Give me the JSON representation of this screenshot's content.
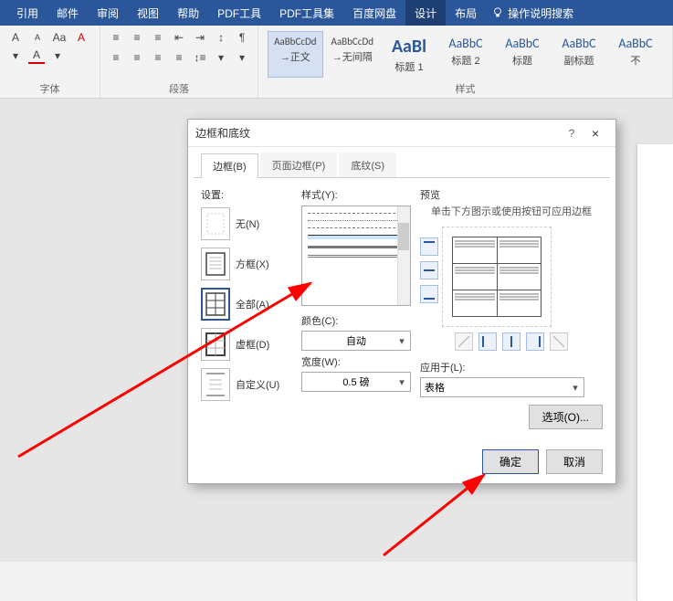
{
  "ribbon": {
    "tabs": [
      "引用",
      "邮件",
      "审阅",
      "视图",
      "帮助",
      "PDF工具",
      "PDF工具集",
      "百度网盘",
      "设计",
      "布局"
    ],
    "help_search": "操作说明搜索"
  },
  "ribbon_groups": {
    "font": "字体",
    "paragraph": "段落",
    "styles": "样式"
  },
  "styles_gallery": [
    {
      "preview": "AaBbCcDd",
      "name": "→正文",
      "size": "small"
    },
    {
      "preview": "AaBbCcDd",
      "name": "→无间隔",
      "size": "small"
    },
    {
      "preview": "AaBl",
      "name": "标题 1",
      "size": "big"
    },
    {
      "preview": "AaBbC",
      "name": "标题 2",
      "size": "med"
    },
    {
      "preview": "AaBbC",
      "name": "标题",
      "size": "med"
    },
    {
      "preview": "AaBbC",
      "name": "副标题",
      "size": "med"
    },
    {
      "preview": "AaBbC",
      "name": "不",
      "size": "med"
    }
  ],
  "dialog": {
    "title": "边框和底纹",
    "tabs": {
      "borders": "边框(B)",
      "page_border": "页面边框(P)",
      "shading": "底纹(S)"
    },
    "settings_label": "设置:",
    "settings": {
      "none": "无(N)",
      "box": "方框(X)",
      "all": "全部(A)",
      "grid": "虚框(D)",
      "custom": "自定义(U)"
    },
    "style_label": "样式(Y):",
    "color_label": "颜色(C):",
    "color_value": "自动",
    "width_label": "宽度(W):",
    "width_value": "0.5 磅",
    "preview_label": "预览",
    "preview_hint": "单击下方图示或使用按钮可应用边框",
    "apply_to_label": "应用于(L):",
    "apply_to_value": "表格",
    "options_btn": "选项(O)...",
    "ok_btn": "确定",
    "cancel_btn": "取消",
    "help": "?",
    "close": "×"
  }
}
